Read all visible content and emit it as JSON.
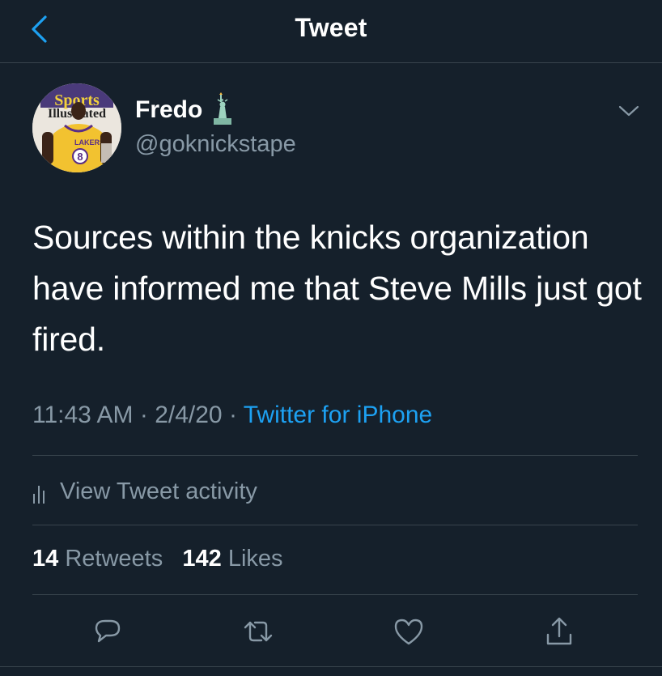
{
  "header": {
    "title": "Tweet",
    "back_icon": "chevron-left-icon"
  },
  "user": {
    "display_name": "Fredo",
    "handle": "@goknickstape",
    "name_emoji": "statue-of-liberty-icon"
  },
  "tweet": {
    "text": "Sources within the knicks organization have informed me that Steve Mills just got fired.",
    "time": "11:43 AM",
    "separator": " · ",
    "date": "2/4/20",
    "source": "Twitter for iPhone"
  },
  "activity": {
    "label": "View Tweet activity"
  },
  "stats": {
    "retweets_count": "14",
    "retweets_label": "Retweets",
    "likes_count": "142",
    "likes_label": "Likes"
  },
  "actions": [
    "reply-icon",
    "retweet-icon",
    "like-icon",
    "share-icon"
  ],
  "colors": {
    "background": "#15202b",
    "accent": "#1da1f2",
    "muted": "#8899a6",
    "divider": "#38444d"
  }
}
